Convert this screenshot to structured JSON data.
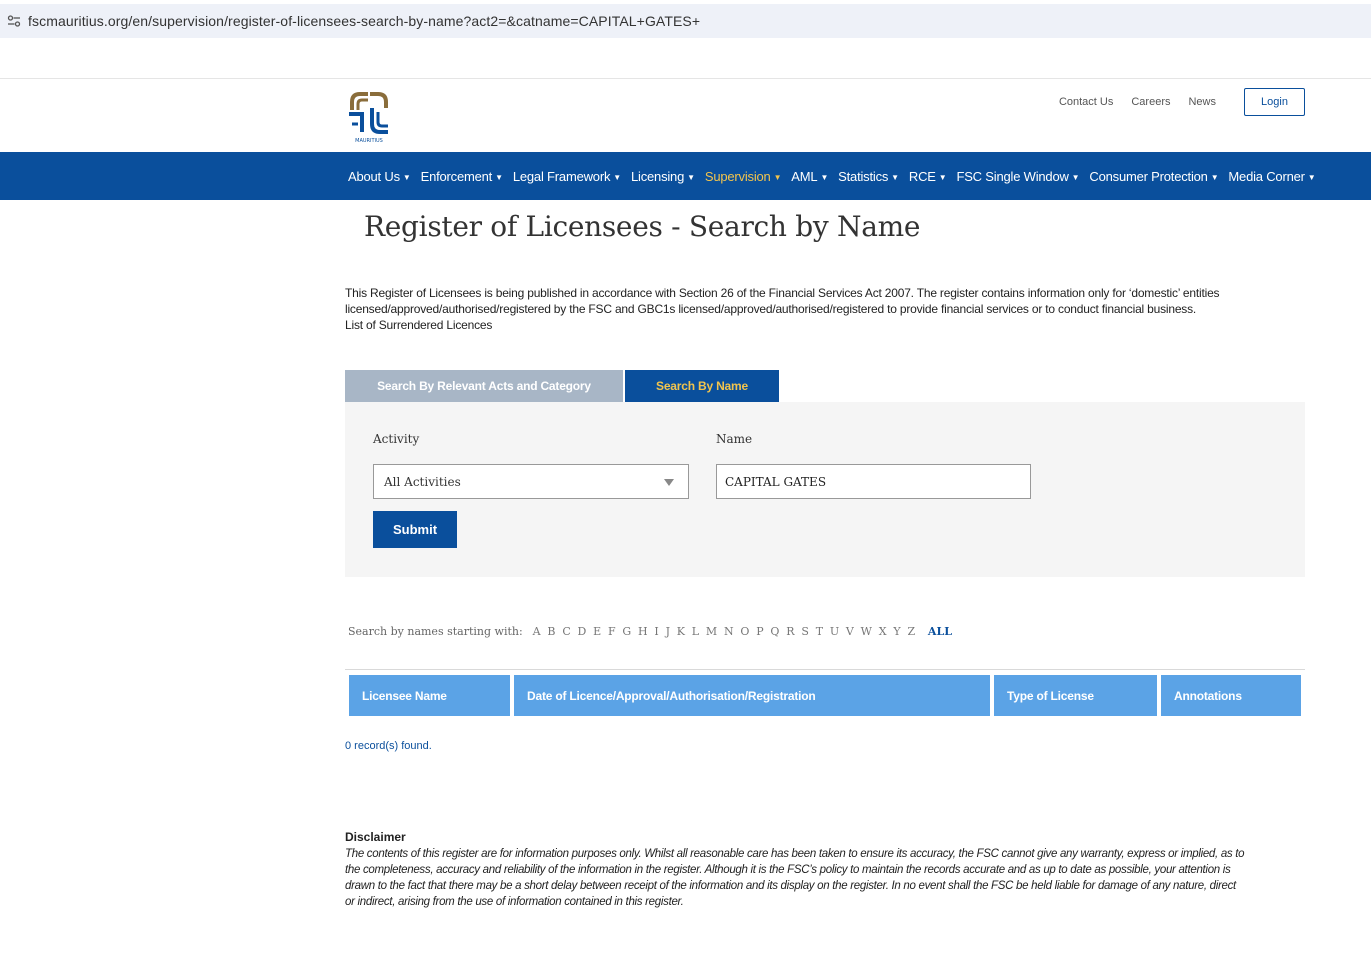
{
  "browser": {
    "url": "fscmauritius.org/en/supervision/register-of-licensees-search-by-name?act2=&catname=CAPITAL+GATES+"
  },
  "header": {
    "logo_text": "MAURITIUS",
    "top_links": [
      "Contact Us",
      "Careers",
      "News"
    ],
    "login_label": "Login",
    "brand_color": "#0a4f9c",
    "accent_color": "#f2c44d",
    "logo_color": "#8a6d3b"
  },
  "nav": {
    "items": [
      {
        "label": "About Us",
        "active": false
      },
      {
        "label": "Enforcement",
        "active": false
      },
      {
        "label": "Legal Framework",
        "active": false
      },
      {
        "label": "Licensing",
        "active": false
      },
      {
        "label": "Supervision",
        "active": true
      },
      {
        "label": "AML",
        "active": false
      },
      {
        "label": "Statistics",
        "active": false
      },
      {
        "label": "RCE",
        "active": false
      },
      {
        "label": "FSC Single Window",
        "active": false
      },
      {
        "label": "Consumer Protection",
        "active": false
      },
      {
        "label": "Media Corner",
        "active": false
      }
    ]
  },
  "page": {
    "title": "Register of Licensees - Search by Name",
    "intro_line1": "This Register of Licensees is being published in accordance with Section 26 of the Financial Services Act 2007. The register contains information only for ‘domestic’ entities",
    "intro_line2": "licensed/approved/authorised/registered by the FSC and GBC1s licensed/approved/authorised/registered to provide financial services or to conduct financial business.",
    "surrendered_link": "List of Surrendered Licences"
  },
  "tabs": [
    {
      "label": "Search By Relevant Acts and Category",
      "active": false
    },
    {
      "label": "Search By Name",
      "active": true
    }
  ],
  "search": {
    "activity_label": "Activity",
    "activity_value": "All Activities",
    "name_label": "Name",
    "name_value": "CAPITAL GATES",
    "submit_label": "Submit"
  },
  "alphabet": {
    "label": "Search by names starting with:",
    "letters": [
      "A",
      "B",
      "C",
      "D",
      "E",
      "F",
      "G",
      "H",
      "I",
      "J",
      "K",
      "L",
      "M",
      "N",
      "O",
      "P",
      "Q",
      "R",
      "S",
      "T",
      "U",
      "V",
      "W",
      "X",
      "Y",
      "Z"
    ],
    "all_label": "ALL"
  },
  "table": {
    "headers": [
      "Licensee Name",
      "Date of Licence/Approval/Authorisation/Registration",
      "Type of License",
      "Annotations"
    ],
    "header_color": "#5ba3e6",
    "records_text": "0 record(s) found."
  },
  "disclaimer": {
    "title": "Disclaimer",
    "line1": "The contents of this register are for information purposes only. Whilst all reasonable care has been taken to ensure its accuracy, the FSC cannot give any warranty, express or implied, as to",
    "line2": "the completeness, accuracy and reliability of the information in the register. Although it is the FSC’s policy to maintain the records accurate and as up to date as possible, your attention is",
    "line3": "drawn to the fact that there may be a short delay between receipt of the information and its display on the register. In no event shall the FSC be held liable for damage of any nature, direct",
    "line4": "or indirect, arising from the use of information contained in this register."
  }
}
